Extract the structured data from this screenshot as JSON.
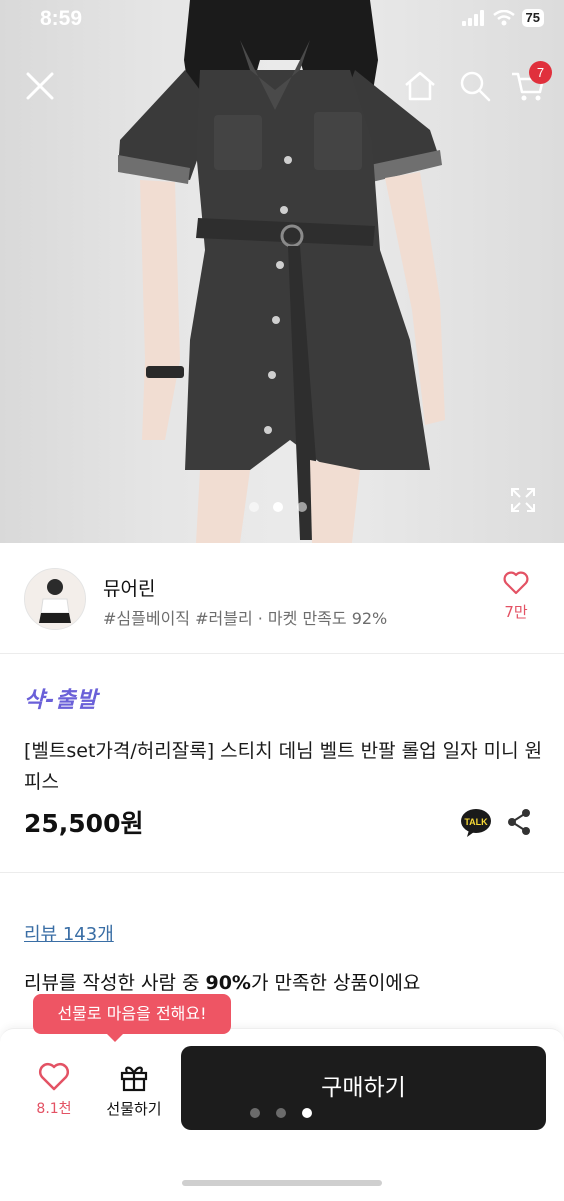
{
  "status_bar": {
    "time": "8:59",
    "battery": "75"
  },
  "hero": {
    "cart_badge": "7",
    "carousel": {
      "count": 3,
      "active_index": 1
    }
  },
  "seller": {
    "name": "뮤어린",
    "tags": "#심플베이직 #러블리 · 마켓 만족도 92%",
    "likes": "7만"
  },
  "product": {
    "brand": "샥-출발",
    "title": "[벨트set가격/허리잘록] 스티치 데님 벨트 반팔 롤업 일자 미니 원피스",
    "price": "25,500원",
    "talk_label": "TALK"
  },
  "review": {
    "link": "리뷰 143개",
    "summary_prefix": "리뷰를 작성한 사람 중 ",
    "summary_highlight": "90%",
    "summary_suffix": "가 만족한 상품이에요"
  },
  "bottom_bar": {
    "tooltip": "선물로 마음을 전해요!",
    "wish_count": "8.1천",
    "gift_label": "선물하기",
    "buy_label": "구매하기",
    "dots": {
      "count": 3,
      "active_index": 2
    }
  },
  "colors": {
    "accent_pink": "#ee5564",
    "like_red": "#e35264",
    "brand_purple": "#6a60d8",
    "buy_button": "#1c1c1c",
    "review_link": "#3a6ea5"
  }
}
